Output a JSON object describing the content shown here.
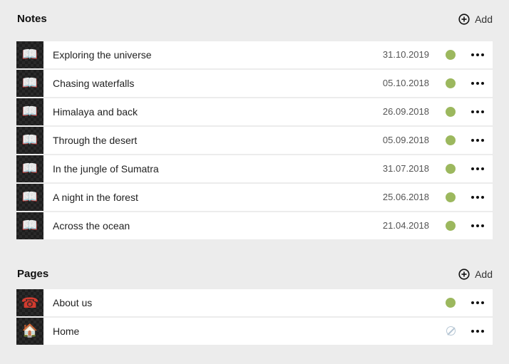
{
  "notes": {
    "title": "Notes",
    "add_label": "Add",
    "items": [
      {
        "title": "Exploring the universe",
        "date": "31.10.2019",
        "icon": "📖"
      },
      {
        "title": "Chasing waterfalls",
        "date": "05.10.2018",
        "icon": "📖"
      },
      {
        "title": "Himalaya and back",
        "date": "26.09.2018",
        "icon": "📖"
      },
      {
        "title": "Through the desert",
        "date": "05.09.2018",
        "icon": "📖"
      },
      {
        "title": "In the jungle of Sumatra",
        "date": "31.07.2018",
        "icon": "📖"
      },
      {
        "title": "A night in the forest",
        "date": "25.06.2018",
        "icon": "📖"
      },
      {
        "title": "Across the ocean",
        "date": "21.04.2018",
        "icon": "📖"
      }
    ]
  },
  "pages": {
    "title": "Pages",
    "add_label": "Add",
    "items": [
      {
        "title": "About us",
        "icon": "☎",
        "status": "published"
      },
      {
        "title": "Home",
        "icon": "🏠",
        "status": "disabled"
      }
    ]
  },
  "colors": {
    "background": "#ececec",
    "status_published": "#9cb85e",
    "status_disabled": "#b6c6d4"
  },
  "icons": {
    "add": "plus-circle-icon",
    "more": "more-dots-icon",
    "note_thumb": "open-book-icon",
    "page_about": "telephone-icon",
    "page_home": "house-icon"
  }
}
